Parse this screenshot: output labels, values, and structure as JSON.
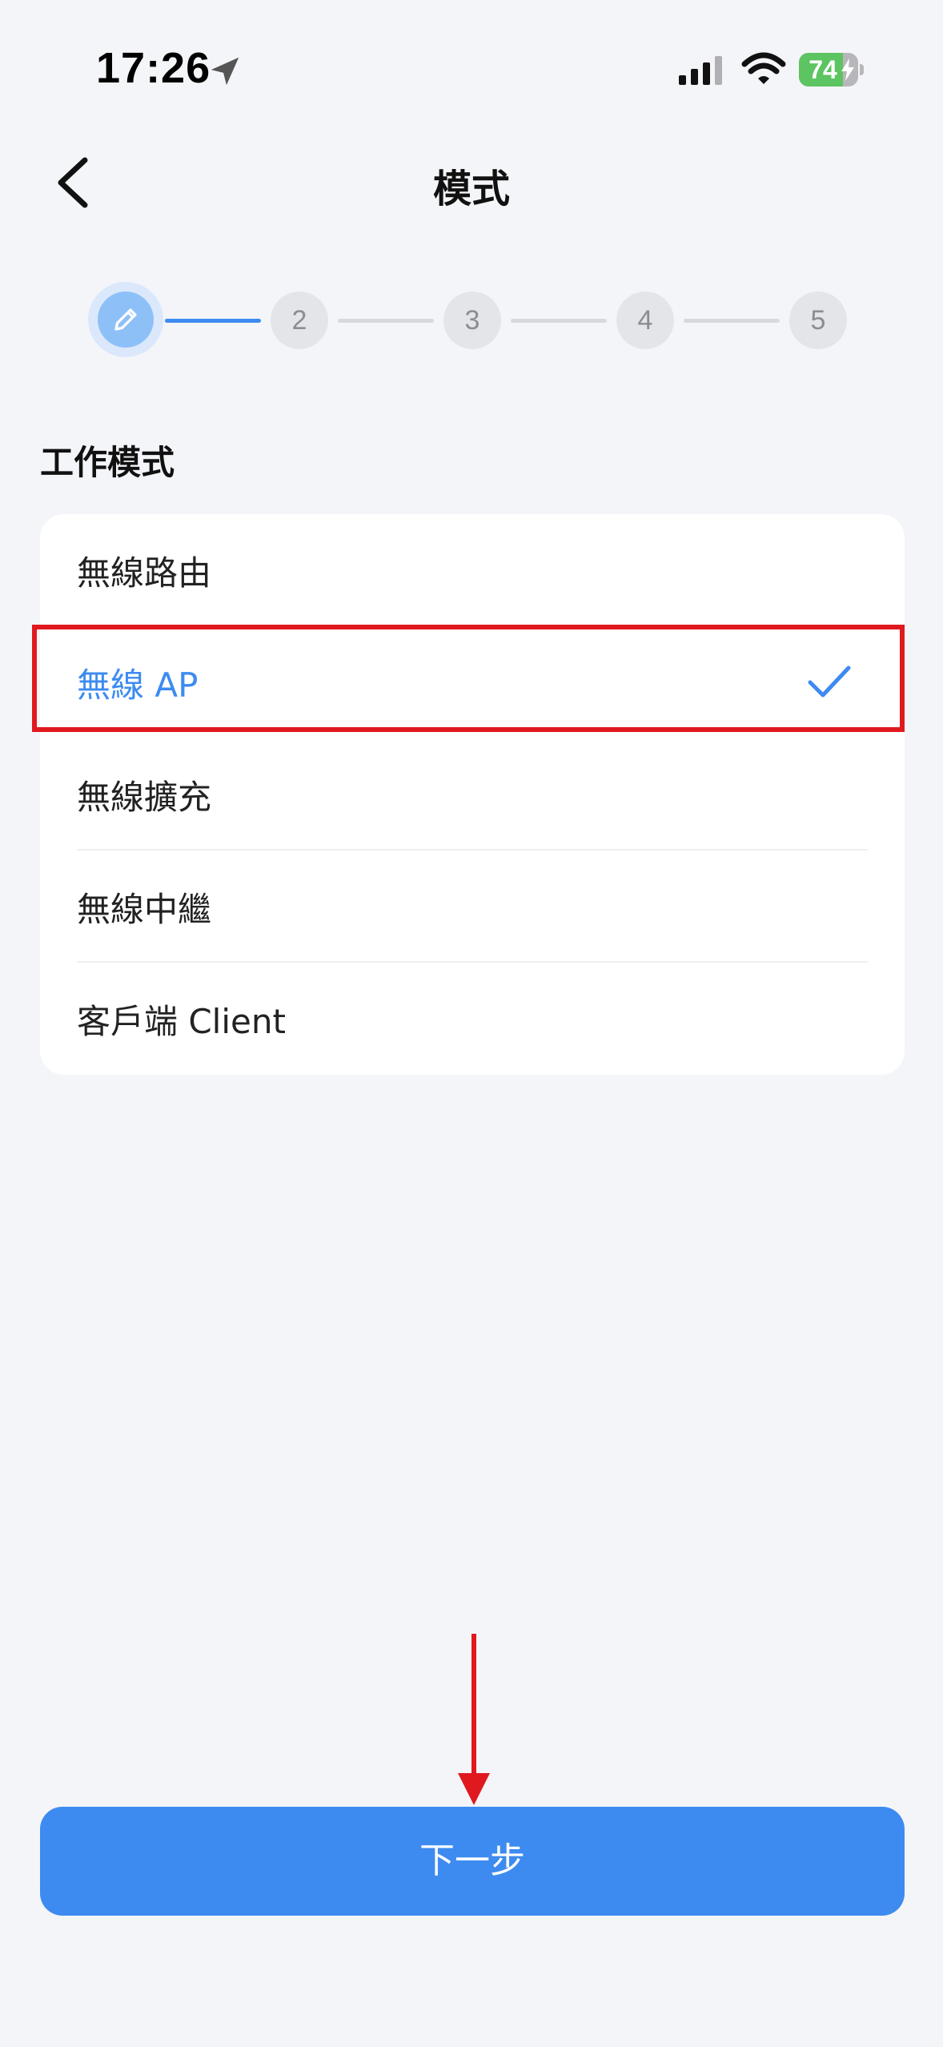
{
  "status_bar": {
    "time": "17:26",
    "battery_percent": "74",
    "battery_level": 0.74,
    "icons": [
      "location-arrow-icon",
      "signal-icon",
      "wifi-icon",
      "battery-charging-icon"
    ]
  },
  "header": {
    "title": "模式",
    "back_icon": "chevron-left-icon"
  },
  "stepper": {
    "current_step": 1,
    "current_icon": "pencil-icon",
    "steps": [
      "2",
      "3",
      "4",
      "5"
    ]
  },
  "section": {
    "title": "工作模式"
  },
  "modes": {
    "items": [
      {
        "label": "無線路由",
        "selected": false
      },
      {
        "label": "無線 AP",
        "selected": true
      },
      {
        "label": "無線擴充",
        "selected": false
      },
      {
        "label": "無線中繼",
        "selected": false
      },
      {
        "label": "客戶端 Client",
        "selected": false
      }
    ],
    "selected_icon": "checkmark-icon"
  },
  "footer": {
    "next_label": "下一步"
  },
  "colors": {
    "accent": "#3d8bf0",
    "annotation": "#e0191f",
    "background": "#f4f5f8"
  }
}
